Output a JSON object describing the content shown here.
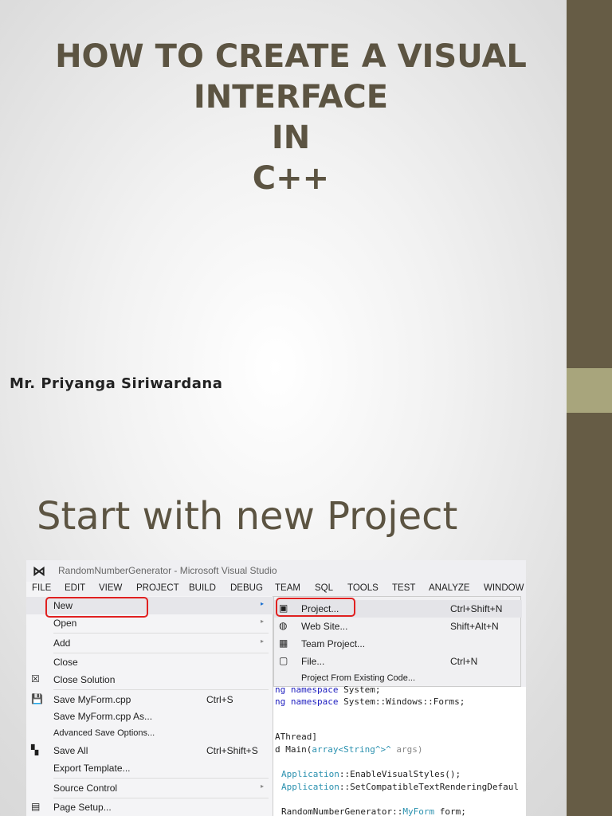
{
  "slide1": {
    "title_lines": [
      "HOW TO CREATE A VISUAL",
      "INTERFACE",
      "IN",
      "C++"
    ],
    "author": "Mr. Priyanga Siriwardana"
  },
  "slide2": {
    "heading": "Start with new Project"
  },
  "colors": {
    "accent_bar": "#665c45",
    "band": "#a8a57c",
    "title": "#5c5442",
    "highlight": "#e02020"
  },
  "vs": {
    "window_title": "RandomNumberGenerator - Microsoft Visual Studio",
    "menubar": [
      "FILE",
      "EDIT",
      "VIEW",
      "PROJECT",
      "BUILD",
      "DEBUG",
      "TEAM",
      "SQL",
      "TOOLS",
      "TEST",
      "ANALYZE",
      "WINDOW"
    ],
    "file_menu": [
      {
        "label": "New",
        "shortcut": "",
        "arrow": "▸"
      },
      {
        "label": "Open",
        "shortcut": "",
        "arrow": "▸"
      },
      {
        "label": "Add",
        "shortcut": "",
        "arrow": "▸"
      },
      {
        "label": "Close",
        "shortcut": ""
      },
      {
        "label": "Close Solution",
        "shortcut": "",
        "icon": "☒"
      },
      {
        "label": "Save MyForm.cpp",
        "shortcut": "Ctrl+S",
        "icon": "💾"
      },
      {
        "label": "Save MyForm.cpp As...",
        "shortcut": ""
      },
      {
        "label": "Advanced Save Options...",
        "shortcut": ""
      },
      {
        "label": "Save All",
        "shortcut": "Ctrl+Shift+S",
        "icon": "▚"
      },
      {
        "label": "Export Template...",
        "shortcut": ""
      },
      {
        "label": "Source Control",
        "shortcut": "",
        "arrow": "▸"
      },
      {
        "label": "Page Setup...",
        "shortcut": "",
        "icon": "▤"
      }
    ],
    "new_submenu": [
      {
        "label": "Project...",
        "shortcut": "Ctrl+Shift+N",
        "icon": "▣"
      },
      {
        "label": "Web Site...",
        "shortcut": "Shift+Alt+N",
        "icon": "◍"
      },
      {
        "label": "Team Project...",
        "shortcut": "",
        "icon": "▦"
      },
      {
        "label": "File...",
        "shortcut": "Ctrl+N",
        "icon": "▢"
      },
      {
        "label": "Project From Existing Code...",
        "shortcut": ""
      }
    ],
    "code": {
      "l1a": "ng namespace",
      "l1b": " System;",
      "l2a": "ng namespace",
      "l2b": " System::Windows::Forms;",
      "l3": "AThread]",
      "l4a": "d Main(",
      "l4b": "array<String^>^",
      "l4c": " args)",
      "l5a": "Application",
      "l5b": "::EnableVisualStyles();",
      "l6a": "Application",
      "l6b": "::SetCompatibleTextRenderingDefaul",
      "l7a": "RandomNumberGenerator::",
      "l7b": "MyForm",
      "l7c": " form;"
    }
  }
}
